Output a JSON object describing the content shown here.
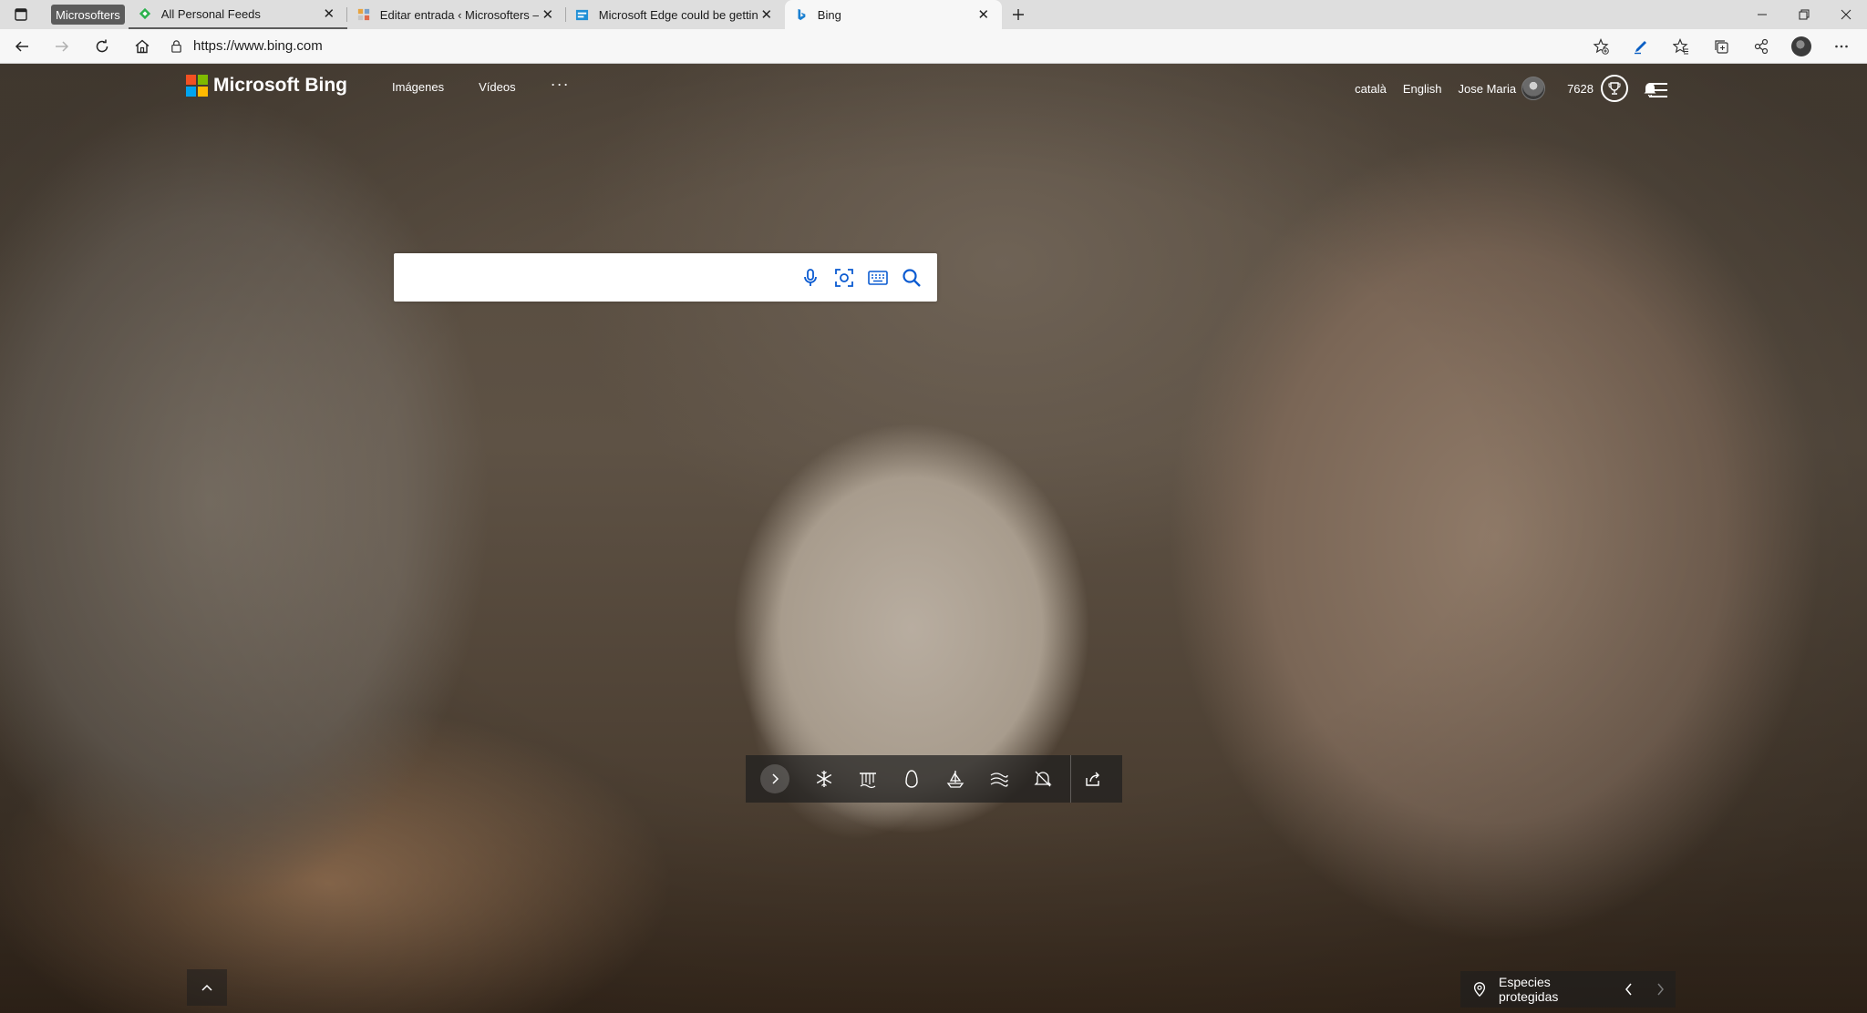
{
  "browser": {
    "tab_group_label": "Microsofters",
    "tabs": [
      {
        "title": "All Personal Feeds",
        "favicon": "feedly-icon"
      },
      {
        "title": "Editar entrada ‹ Microsofters — W",
        "favicon": "wordpress-icon"
      },
      {
        "title": "Microsoft Edge could be getting a",
        "favicon": "news-icon"
      },
      {
        "title": "Bing",
        "favicon": "bing-icon"
      }
    ],
    "active_tab_index": 3,
    "address": "https://www.bing.com"
  },
  "bing": {
    "logo_text": "Microsoft Bing",
    "nav": {
      "images": "Imágenes",
      "videos": "Vídeos",
      "more": "···"
    },
    "lang_catala": "català",
    "lang_english": "English",
    "user_name": "Jose Maria",
    "points": "7628",
    "search_placeholder": "",
    "location_label": "Especies protegidas"
  },
  "colors": {
    "ms_red": "#f25022",
    "ms_green": "#7fba00",
    "ms_blue": "#00a4ef",
    "ms_yellow": "#ffb900",
    "edge_blue": "#0a5fc4"
  }
}
